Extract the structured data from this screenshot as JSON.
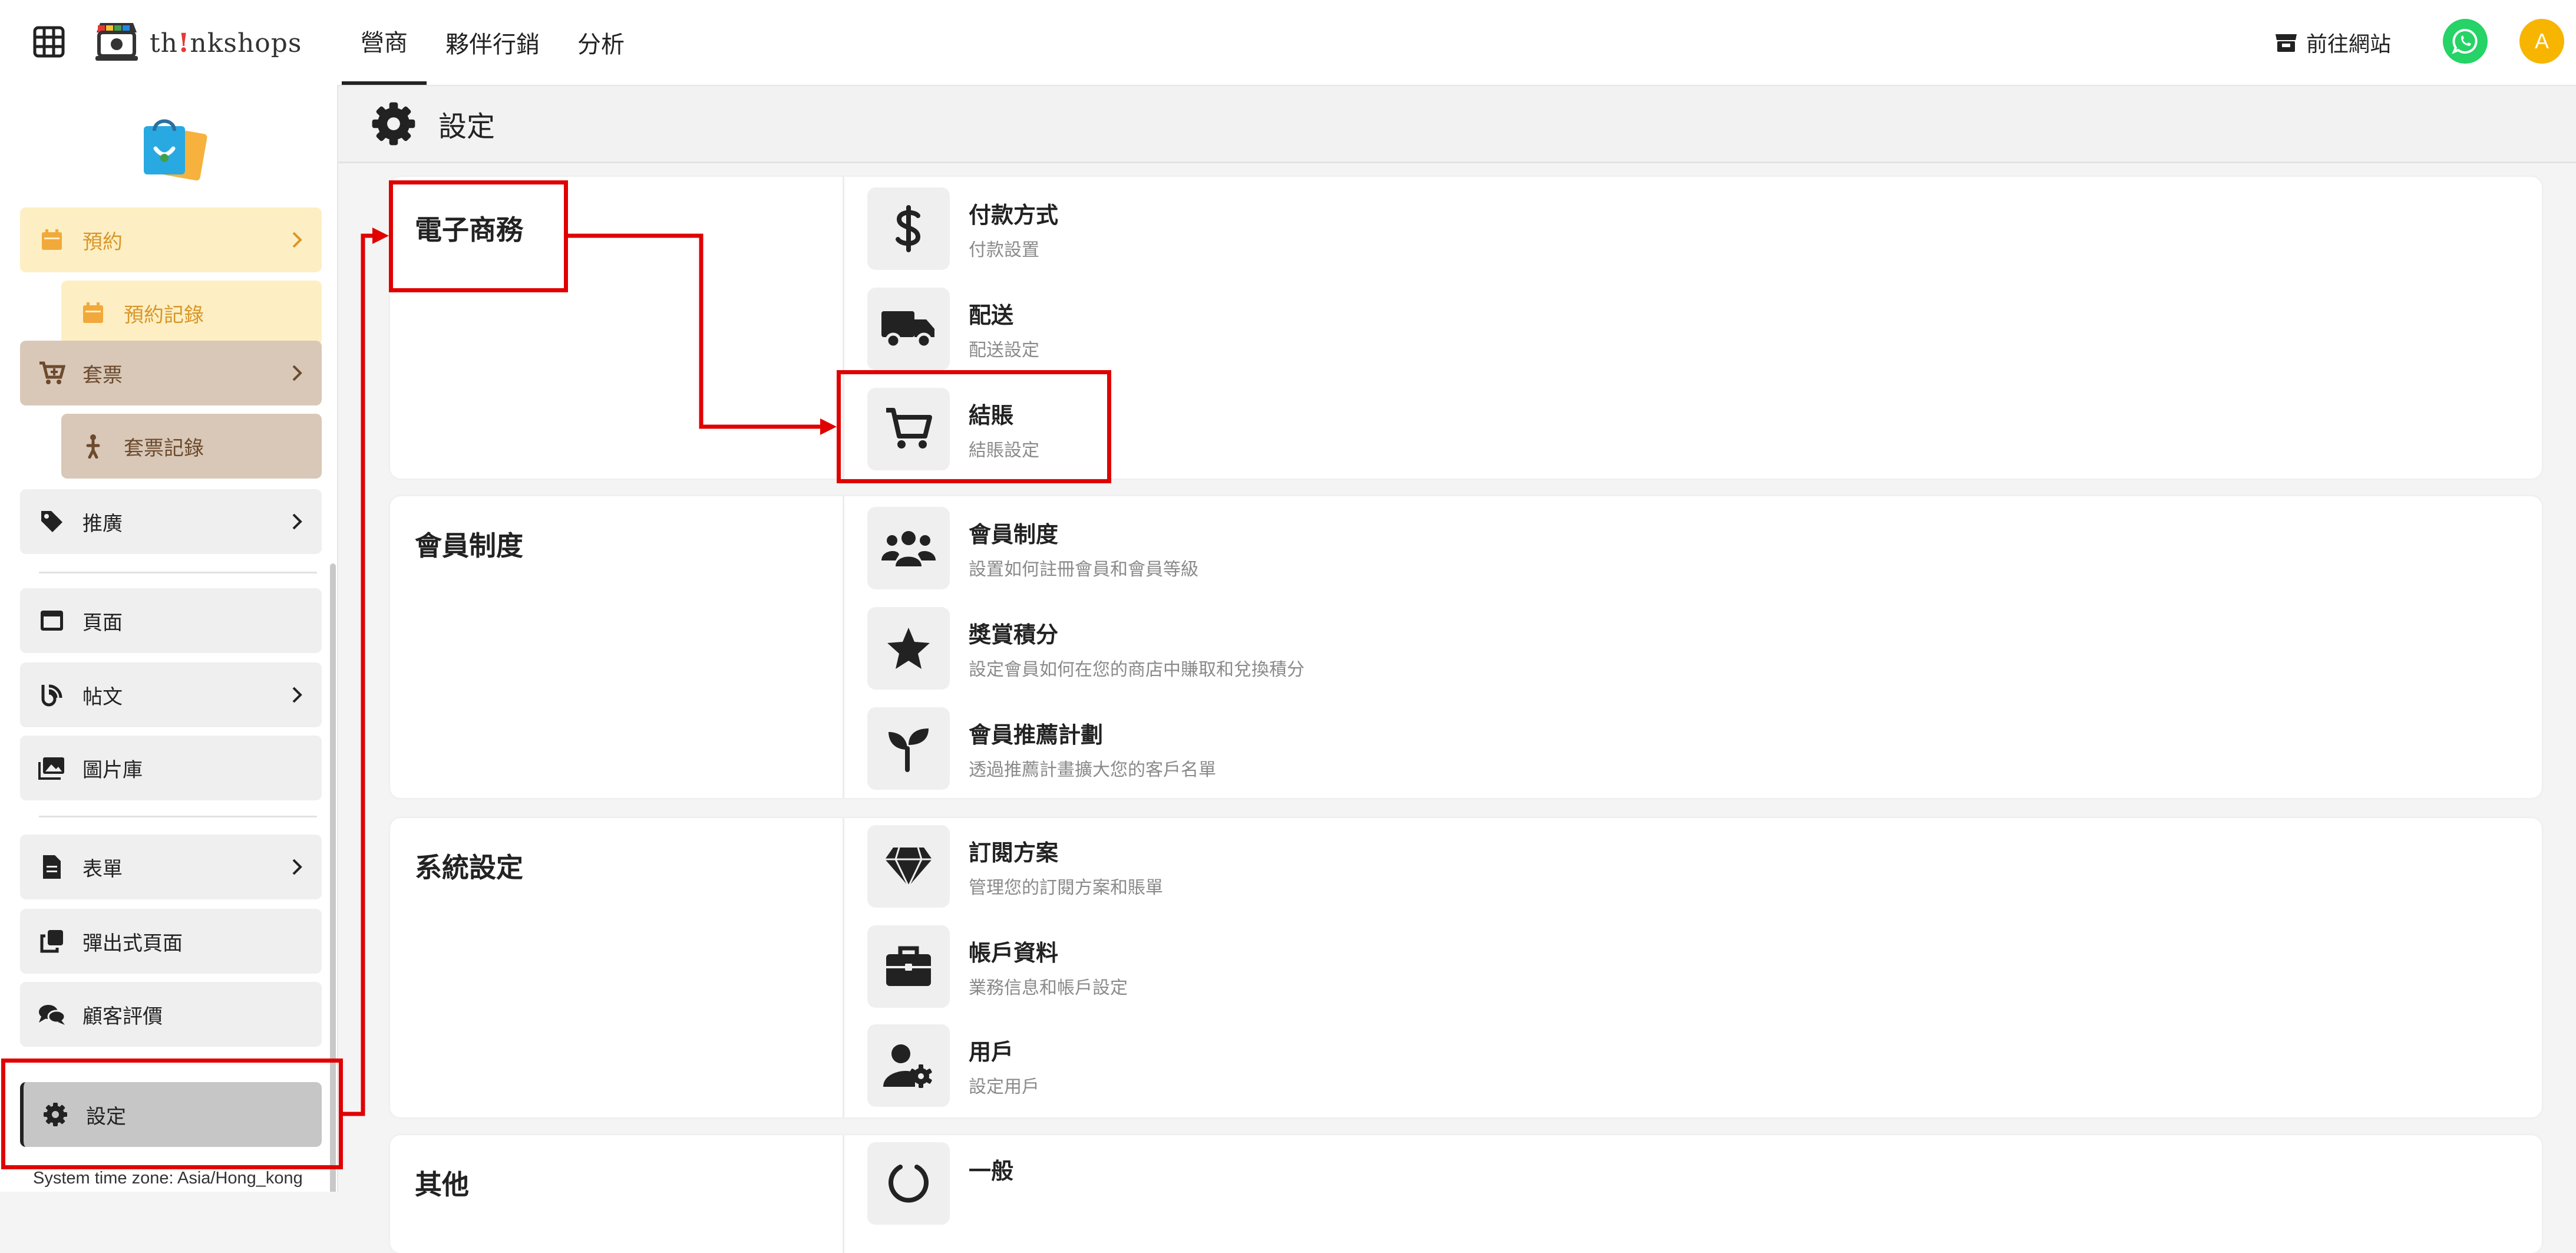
{
  "topbar": {
    "brand_prefix": "th",
    "brand_bang": "!",
    "brand_suffix": "nkshops",
    "nav": [
      "營商",
      "夥伴行銷",
      "分析"
    ],
    "visit_label": "前往網站",
    "avatar_initial": "A"
  },
  "sidebar": {
    "items": {
      "booking": "預約",
      "booking_records": "預約記錄",
      "packages": "套票",
      "package_records": "套票記錄",
      "promotion": "推廣",
      "pages": "頁面",
      "posts": "帖文",
      "gallery": "圖片庫",
      "forms": "表單",
      "popups": "彈出式頁面",
      "reviews": "顧客評價",
      "settings": "設定"
    },
    "timezone": "System time zone: Asia/Hong_kong"
  },
  "header": {
    "title": "設定"
  },
  "sections": {
    "ecommerce": {
      "title": "電子商務",
      "items": [
        {
          "title": "付款方式",
          "desc": "付款設置",
          "icon": "dollar-icon"
        },
        {
          "title": "配送",
          "desc": "配送設定",
          "icon": "truck-icon"
        },
        {
          "title": "結賬",
          "desc": "結賬設定",
          "icon": "cart-icon"
        }
      ]
    },
    "membership": {
      "title": "會員制度",
      "items": [
        {
          "title": "會員制度",
          "desc": "設置如何註冊會員和會員等級",
          "icon": "users-icon"
        },
        {
          "title": "獎賞積分",
          "desc": "設定會員如何在您的商店中賺取和兌換積分",
          "icon": "star-icon"
        },
        {
          "title": "會員推薦計劃",
          "desc": "透過推薦計畫擴大您的客戶名單",
          "icon": "seedling-icon"
        }
      ]
    },
    "system": {
      "title": "系統設定",
      "items": [
        {
          "title": "訂閱方案",
          "desc": "管理您的訂閱方案和賬單",
          "icon": "gem-icon"
        },
        {
          "title": "帳戶資料",
          "desc": "業務信息和帳戶設定",
          "icon": "briefcase-icon"
        },
        {
          "title": "用戶",
          "desc": "設定用戶",
          "icon": "user-gear-icon"
        }
      ]
    },
    "other": {
      "title": "其他",
      "items": [
        {
          "title": "一般",
          "icon": "circle-icon"
        }
      ]
    }
  },
  "colors": {
    "annotation": "#e00000",
    "whatsapp": "#25d366",
    "avatar": "#f7b500",
    "booking_bg": "#fdefc3",
    "package_bg": "#d9c8b8"
  }
}
